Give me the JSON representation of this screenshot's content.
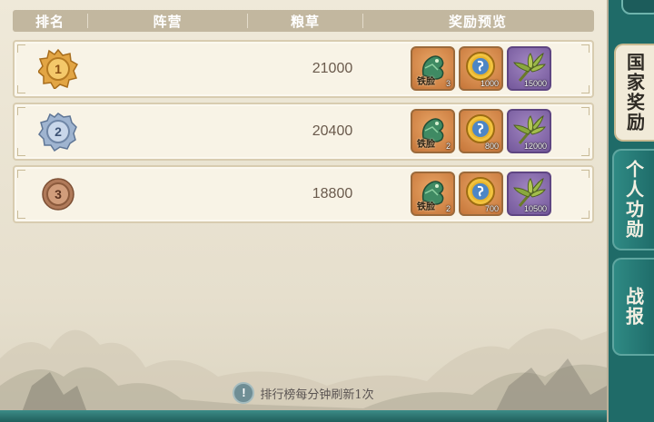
{
  "header": {
    "col_rank": "排名",
    "col_faction": "阵营",
    "col_grain": "粮草",
    "col_rewards": "奖励预览"
  },
  "rows": [
    {
      "rank": "1",
      "faction": "",
      "grain": "21000",
      "rewards": [
        {
          "icon": "jade-dragon-seal-icon",
          "label": "铁脸",
          "qty": "3",
          "color": "#d58b4f"
        },
        {
          "icon": "gold-coin-icon",
          "qty": "1000",
          "color": "#d58b4f"
        },
        {
          "icon": "grain-bundle-icon",
          "qty": "15000",
          "color": "#8a6cae"
        }
      ]
    },
    {
      "rank": "2",
      "faction": "",
      "grain": "20400",
      "rewards": [
        {
          "icon": "jade-dragon-seal-icon",
          "label": "铁脸",
          "qty": "2",
          "color": "#d58b4f"
        },
        {
          "icon": "gold-coin-icon",
          "qty": "800",
          "color": "#d58b4f"
        },
        {
          "icon": "grain-bundle-icon",
          "qty": "12000",
          "color": "#8a6cae"
        }
      ]
    },
    {
      "rank": "3",
      "faction": "",
      "grain": "18800",
      "rewards": [
        {
          "icon": "jade-dragon-seal-icon",
          "label": "铁脸",
          "qty": "2",
          "color": "#d58b4f"
        },
        {
          "icon": "gold-coin-icon",
          "qty": "700",
          "color": "#d58b4f"
        },
        {
          "icon": "grain-bundle-icon",
          "qty": "10500",
          "color": "#8a6cae"
        }
      ]
    }
  ],
  "medal_colors": [
    "#e2a544",
    "#9fb4d0",
    "#b07a5a"
  ],
  "footer": {
    "icon": "exclamation-icon",
    "text": "排行榜每分钟刷新1次"
  },
  "side_tabs": [
    {
      "label": "国家奖励",
      "active": true
    },
    {
      "label": "个人功勋",
      "active": false
    },
    {
      "label": "战报",
      "active": false
    }
  ]
}
